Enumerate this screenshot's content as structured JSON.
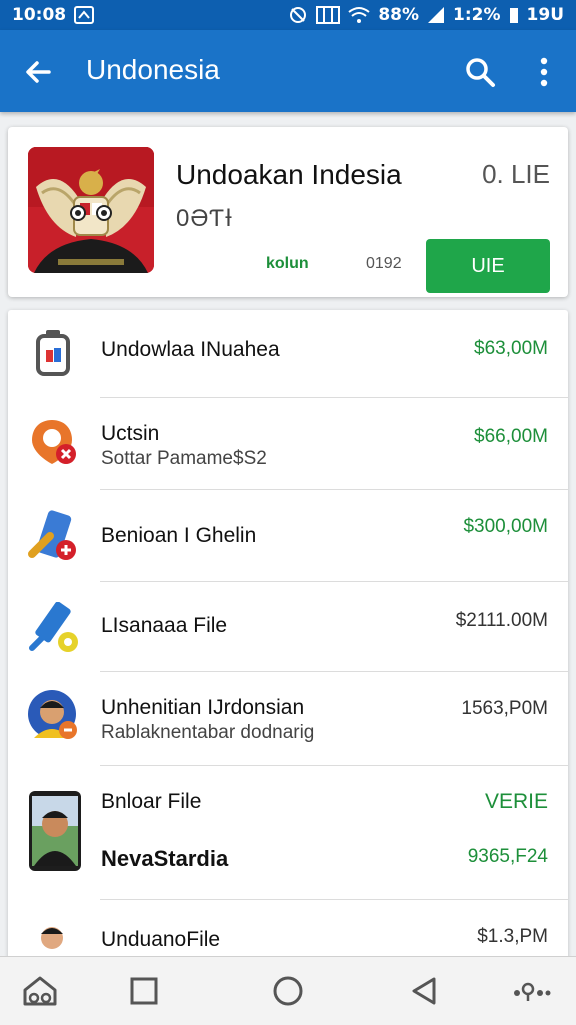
{
  "status_bar": {
    "time": "10:08",
    "battery_text": "88%",
    "clock_right": "1:2%",
    "extra": "19U"
  },
  "app_bar": {
    "title": "Undonesia",
    "back_icon": "arrow-back-icon",
    "search_icon": "search-icon",
    "more_icon": "more-vert-icon",
    "color": "#1a73c8"
  },
  "featured": {
    "title": "Undoakan Indesia",
    "size": "0. LIE",
    "subtitle": "0ƏƬƗ",
    "link": "kolun",
    "count": "0192",
    "button_label": "UIE",
    "button_color": "#1fa64a"
  },
  "list": [
    {
      "title": "Undowlaa INuahea",
      "subtitle": "",
      "price": "$63,00M",
      "price_color": "green",
      "icon": "file-doc-icon"
    },
    {
      "title": "Uctsin",
      "subtitle": "Sottar Pamame$S2",
      "price": "$66,00M",
      "price_color": "green",
      "icon": "location-pin-icon"
    },
    {
      "title": "Benioan I Ghelin",
      "subtitle": "",
      "price": "$300,00M",
      "price_color": "green",
      "icon": "wrench-tool-icon"
    },
    {
      "title": "LIsanaaa File",
      "subtitle": "",
      "price": "$2111.00M",
      "price_color": "gray",
      "icon": "pen-edit-icon"
    },
    {
      "title": "Unhenitian IJrdonsian",
      "subtitle": "Rablaknentabar dodnarig",
      "price": "1563,P0M",
      "price_color": "gray",
      "icon": "avatar-icon"
    },
    {
      "title": "Bnloar File",
      "subtitle": "NevaStardia",
      "price": "VERIE",
      "price2": "9365,F24",
      "price_color": "green",
      "icon": "person-photo-icon"
    },
    {
      "title": "UnduanoFile",
      "subtitle": "",
      "price": "$1.3,PM",
      "price_color": "gray",
      "icon": "person-avatar-icon"
    }
  ],
  "nav_bar": {
    "items": [
      "home-icon",
      "recent-apps-icon",
      "home-circle-icon",
      "back-triangle-icon",
      "menu-dots-icon"
    ]
  }
}
